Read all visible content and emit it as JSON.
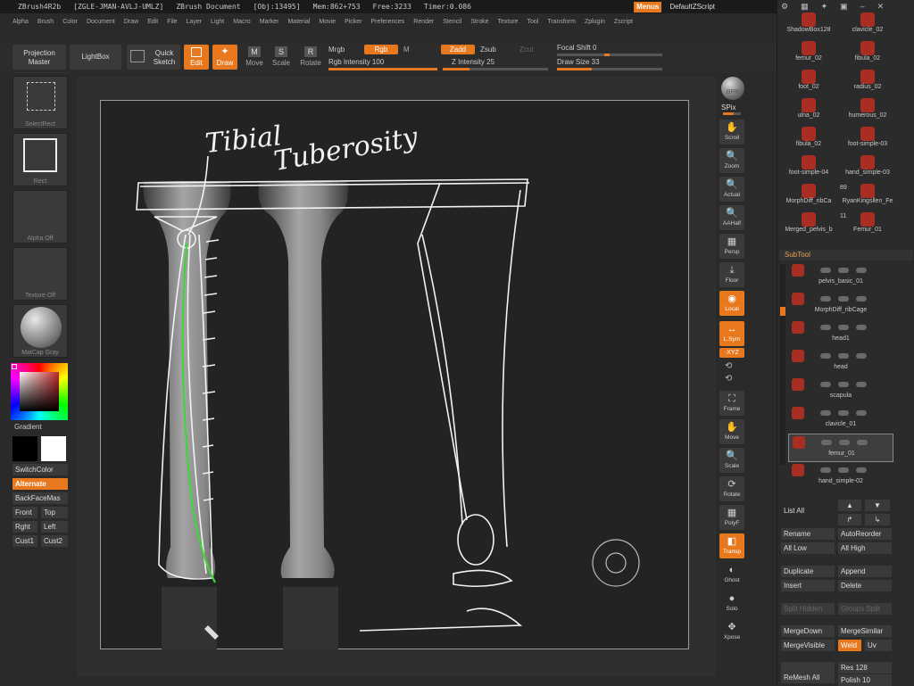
{
  "titlebar": {
    "app": "ZBrush4R2b",
    "build": "[ZGLE-JMAN-AVLJ-UMLZ]",
    "doc": "ZBrush Document",
    "obj": "[Obj:13495]",
    "mem": "Mem:862+753",
    "free": "Free:3233",
    "timer": "Timer:0.086",
    "menus": "Menus",
    "script": "DefaultZScript"
  },
  "menubar": [
    "Alpha",
    "Brush",
    "Color",
    "Document",
    "Draw",
    "Edit",
    "File",
    "Layer",
    "Light",
    "Macro",
    "Marker",
    "Material",
    "Movie",
    "Picker",
    "Preferences",
    "Render",
    "Stencil",
    "Stroke",
    "Texture",
    "Tool",
    "Transform",
    "Zplugin",
    "Zscript"
  ],
  "toolbar": {
    "projection": "Projection Master",
    "lightbox": "LightBox",
    "quick_sketch": "Quick Sketch",
    "edit": "Edit",
    "draw": "Draw",
    "move": "Move",
    "scale": "Scale",
    "rotate": "Rotate",
    "mrgb": "Mrgb",
    "rgb": "Rgb",
    "m": "M",
    "rgb_intensity": "Rgb Intensity 100",
    "rgb_intensity_value": 100,
    "zadd": "Zadd",
    "zsub": "Zsub",
    "zcut": "Zcut",
    "z_intensity": "Z Intensity 25",
    "z_intensity_value": 25,
    "focal_shift": "Focal Shift 0",
    "draw_size": "Draw Size 33",
    "draw_size_value": 33
  },
  "left": {
    "selectrect": "SelectRect",
    "rect": "Rect",
    "alpha_off": "Alpha Off",
    "texture_off": "Texture Off",
    "matcap": "MatCap Gray",
    "gradient": "Gradient",
    "switchcolor": "SwitchColor",
    "alternate": "Alternate",
    "backface": "BackFaceMas",
    "front": "Front",
    "top": "Top",
    "right": "Rght",
    "left": "Left",
    "cust1": "Cust1",
    "cust2": "Cust2"
  },
  "sketch_text": {
    "line1": "Tibial",
    "line2": "Tuberosity"
  },
  "rightbar": {
    "bpr": "BPR",
    "spix": "SPix",
    "scroll": "Scroll",
    "zoom": "Zoom",
    "actual": "Actual",
    "aahalf": "AAHalf",
    "persp": "Persp",
    "floor": "Floor",
    "local": "Local",
    "lsym": "L.Sym",
    "xyz": "∙XYZ",
    "frame": "Frame",
    "move": "Move",
    "scale": "Scale",
    "rotate": "Rotate",
    "polyf": "PolyF",
    "transp": "Transp",
    "ghost": "Ghost",
    "solo": "Solo",
    "xpose": "Xpose"
  },
  "tools": [
    {
      "name": "ShadowBox128"
    },
    {
      "name": "clavicle_02"
    },
    {
      "name": "femur_02"
    },
    {
      "name": "fibula_02"
    },
    {
      "name": "foot_02"
    },
    {
      "name": "radius_02"
    },
    {
      "name": "ulna_02"
    },
    {
      "name": "humerous_02"
    },
    {
      "name": "fibula_02"
    },
    {
      "name": "foot-simple-03"
    },
    {
      "name": "foot-simple-04"
    },
    {
      "name": "hand_simple-03"
    },
    {
      "name": "MorphDiff_ribCa"
    },
    {
      "name": "RyanKingsllen_Fe"
    },
    {
      "name": "Merged_pelvis_b"
    },
    {
      "name": "Femur_01"
    }
  ],
  "tool_counts": {
    "a": "89",
    "b": "11"
  },
  "subtool": {
    "title": "SubTool",
    "items": [
      "pelvis_basic_01",
      "MorphDiff_ribCage",
      "head1",
      "head",
      "scapula",
      "clavicle_01",
      "femur_01",
      "hand_simple-02"
    ]
  },
  "actions": {
    "list_all": "List All",
    "rename": "Rename",
    "auto_reorder": "AutoReorder",
    "all_low": "All Low",
    "all_high": "All High",
    "duplicate": "Duplicate",
    "append": "Append",
    "insert": "Insert",
    "delete": "Delete",
    "split_hidden": "Split Hidden",
    "groups_split": "Groups Split",
    "merge_down": "MergeDown",
    "merge_similar": "MergeSimilar",
    "merge_visible": "MergeVisible",
    "weld": "Weld",
    "uv": "Uv",
    "remesh_all": "ReMesh All",
    "res": "Res 128",
    "polish": "Polish 10"
  }
}
